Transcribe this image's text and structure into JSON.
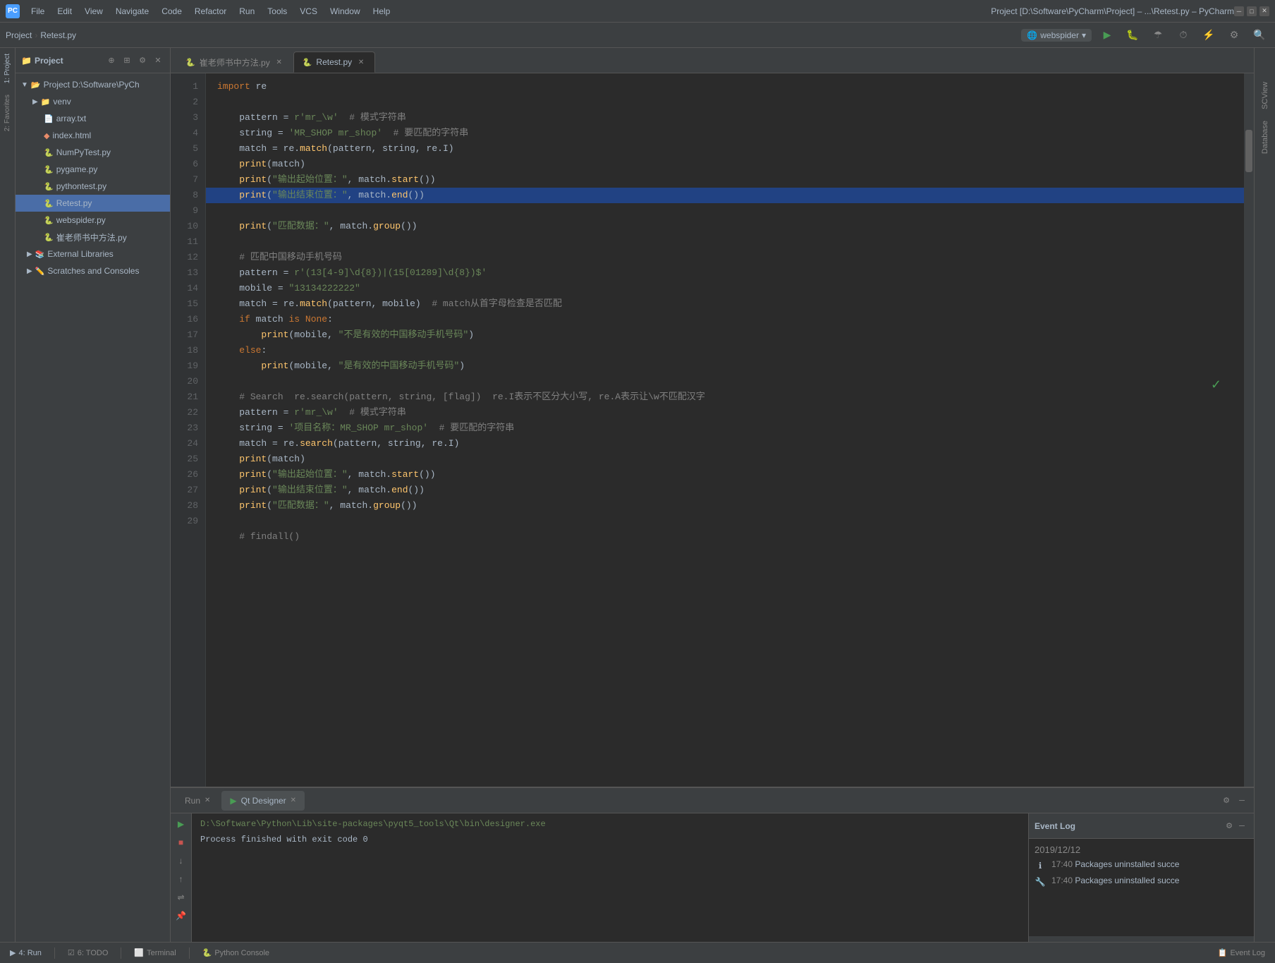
{
  "titlebar": {
    "title": "Project [D:\\Software\\PyCharm\\Project] – ...\\Retest.py – PyCharm",
    "menu_items": [
      "File",
      "Edit",
      "View",
      "Navigate",
      "Code",
      "Refactor",
      "Run",
      "Tools",
      "VCS",
      "Window",
      "Help"
    ],
    "run_config": "webspider",
    "app_icon": "PC"
  },
  "toolbar": {
    "breadcrumb_project": "Project",
    "breadcrumb_file": "Retest.py"
  },
  "project_panel": {
    "title": "Project",
    "root_label": "Project D:\\Software\\PyCh",
    "items": [
      {
        "label": "venv",
        "type": "folder",
        "indent": 1,
        "expanded": true
      },
      {
        "label": "array.txt",
        "type": "txt",
        "indent": 2
      },
      {
        "label": "index.html",
        "type": "html",
        "indent": 2
      },
      {
        "label": "NumPyTest.py",
        "type": "py",
        "indent": 2
      },
      {
        "label": "pygame.py",
        "type": "py",
        "indent": 2
      },
      {
        "label": "pythontest.py",
        "type": "py",
        "indent": 2
      },
      {
        "label": "Retest.py",
        "type": "py",
        "indent": 2,
        "selected": true
      },
      {
        "label": "webspider.py",
        "type": "py",
        "indent": 2
      },
      {
        "label": "崔老师书中方法.py",
        "type": "py",
        "indent": 2
      }
    ],
    "external_libraries": "External Libraries",
    "scratches": "Scratches and Consoles"
  },
  "editor": {
    "tabs": [
      {
        "label": "崔老师书中方法.py",
        "active": false,
        "type": "py"
      },
      {
        "label": "Retest.py",
        "active": true,
        "type": "py"
      }
    ],
    "lines": [
      {
        "num": 1,
        "code": "import re"
      },
      {
        "num": 2,
        "code": ""
      },
      {
        "num": 3,
        "code": "    pattern = r'mr_\\w'  # 模式字符串"
      },
      {
        "num": 4,
        "code": "    string = 'MR_SHOP mr_shop'  # 要匹配的字符串"
      },
      {
        "num": 5,
        "code": "    match = re.match(pattern, string, re.I)"
      },
      {
        "num": 6,
        "code": "    print(match)"
      },
      {
        "num": 7,
        "code": "    print(\"输出起始位置：\", match.start())"
      },
      {
        "num": 8,
        "code": "    print(\"输出结束位置：\", match.end())"
      },
      {
        "num": 9,
        "code": "    print(\"匹配数据：\", match.group())"
      },
      {
        "num": 10,
        "code": ""
      },
      {
        "num": 11,
        "code": "    # 匹配中国移动手机号码"
      },
      {
        "num": 12,
        "code": "    pattern = r'(13[4-9]\\d{8})|(15[01289]\\d{8})$'"
      },
      {
        "num": 13,
        "code": "    mobile = \"13134222222\""
      },
      {
        "num": 14,
        "code": "    match = re.match(pattern, mobile)  # match从首字母检查是否匹配"
      },
      {
        "num": 15,
        "code": "    if match is None:"
      },
      {
        "num": 16,
        "code": "        print(mobile, \"不是有效的中国移动手机号码\")"
      },
      {
        "num": 17,
        "code": "    else:"
      },
      {
        "num": 18,
        "code": "        print(mobile, \"是有效的中国移动手机号码\")"
      },
      {
        "num": 19,
        "code": ""
      },
      {
        "num": 20,
        "code": "    # Search  re.search(pattern, string, [flag])  re.I表示不区分大小写, re.A表示让\\w不匹配汉字"
      },
      {
        "num": 21,
        "code": "    pattern = r'mr_\\w'  # 模式字符串"
      },
      {
        "num": 22,
        "code": "    string = '项目名称：MR_SHOP mr_shop'  # 要匹配的字符串"
      },
      {
        "num": 23,
        "code": "    match = re.search(pattern, string, re.I)"
      },
      {
        "num": 24,
        "code": "    print(match)"
      },
      {
        "num": 25,
        "code": "    print(\"输出起始位置：\", match.start())"
      },
      {
        "num": 26,
        "code": "    print(\"输出结束位置：\", match.end())"
      },
      {
        "num": 27,
        "code": "    print(\"匹配数据：\", match.group())"
      },
      {
        "num": 28,
        "code": ""
      },
      {
        "num": 29,
        "code": "    # findall()"
      }
    ]
  },
  "bottom_panel": {
    "tabs": [
      {
        "label": "Run",
        "active": false
      },
      {
        "label": "Qt Designer",
        "active": true
      }
    ],
    "run_output_path": "D:\\Software\\Python\\Lib\\site-packages\\pyqt5_tools\\Qt\\bin\\designer.exe",
    "run_output_exit": "Process finished with exit code 0"
  },
  "event_log": {
    "title": "Event Log",
    "entries": [
      {
        "date": "2019/12/12",
        "type": "info"
      },
      {
        "time": "17:40",
        "text": "Packages uninstalled succe",
        "type": "success"
      },
      {
        "time": "17:40",
        "text": "Packages uninstalled succe",
        "type": "wrench"
      }
    ]
  },
  "statusbar": {
    "items": [
      {
        "label": "4: Run",
        "icon": "▶"
      },
      {
        "label": "6: TODO",
        "icon": "☑"
      },
      {
        "label": "Terminal",
        "icon": "⬜"
      },
      {
        "label": "Python Console",
        "icon": "🐍"
      },
      {
        "label": "Event Log",
        "icon": "📋"
      }
    ]
  },
  "right_panel": {
    "labels": [
      "SCView",
      "Database"
    ]
  }
}
